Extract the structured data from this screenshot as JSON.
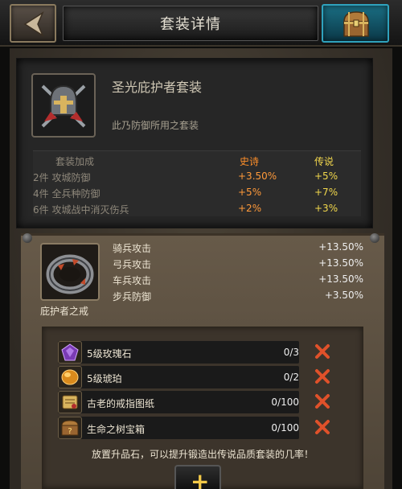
{
  "header": {
    "title": "套装详情",
    "back_icon": "chevron-left-icon",
    "chest_icon": "treasure-chest-icon"
  },
  "set": {
    "name": "圣光庇护者套装",
    "description": "此乃防御所用之套装",
    "icon": "helmet-crossed-swords-icon",
    "bonus_header": {
      "label": "套装加成",
      "epic": "史诗",
      "legendary": "传说"
    },
    "bonuses": [
      {
        "label": "2件 攻城防御",
        "epic": "+3.50%",
        "legendary": "+5%"
      },
      {
        "label": "4件 全兵种防御",
        "epic": "+5%",
        "legendary": "+7%"
      },
      {
        "label": "6件 攻城战中消灭伤兵",
        "epic": "+2%",
        "legendary": "+3%"
      }
    ]
  },
  "item": {
    "name": "庇护者之戒",
    "icon": "ring-icon",
    "stats": [
      {
        "name": "骑兵攻击",
        "value": "+13.50%"
      },
      {
        "name": "弓兵攻击",
        "value": "+13.50%"
      },
      {
        "name": "车兵攻击",
        "value": "+13.50%"
      },
      {
        "name": "步兵防御",
        "value": "+3.50%"
      }
    ]
  },
  "materials": [
    {
      "name": "5级玫瑰石",
      "count": "0/3",
      "icon": "rose-gem-icon"
    },
    {
      "name": "5级琥珀",
      "count": "0/2",
      "icon": "amber-icon"
    },
    {
      "name": "古老的戒指图纸",
      "count": "0/100",
      "icon": "blueprint-scroll-icon"
    },
    {
      "name": "生命之树宝箱",
      "count": "0/100",
      "icon": "mystery-chest-icon"
    }
  ],
  "hint": "放置升品石，可以提升锻造出传说品质套装的几率！",
  "plus_label": "+",
  "colors": {
    "epic": "#ff9a3a",
    "legendary": "#f2d84c",
    "missing_x": "#e0512a"
  }
}
